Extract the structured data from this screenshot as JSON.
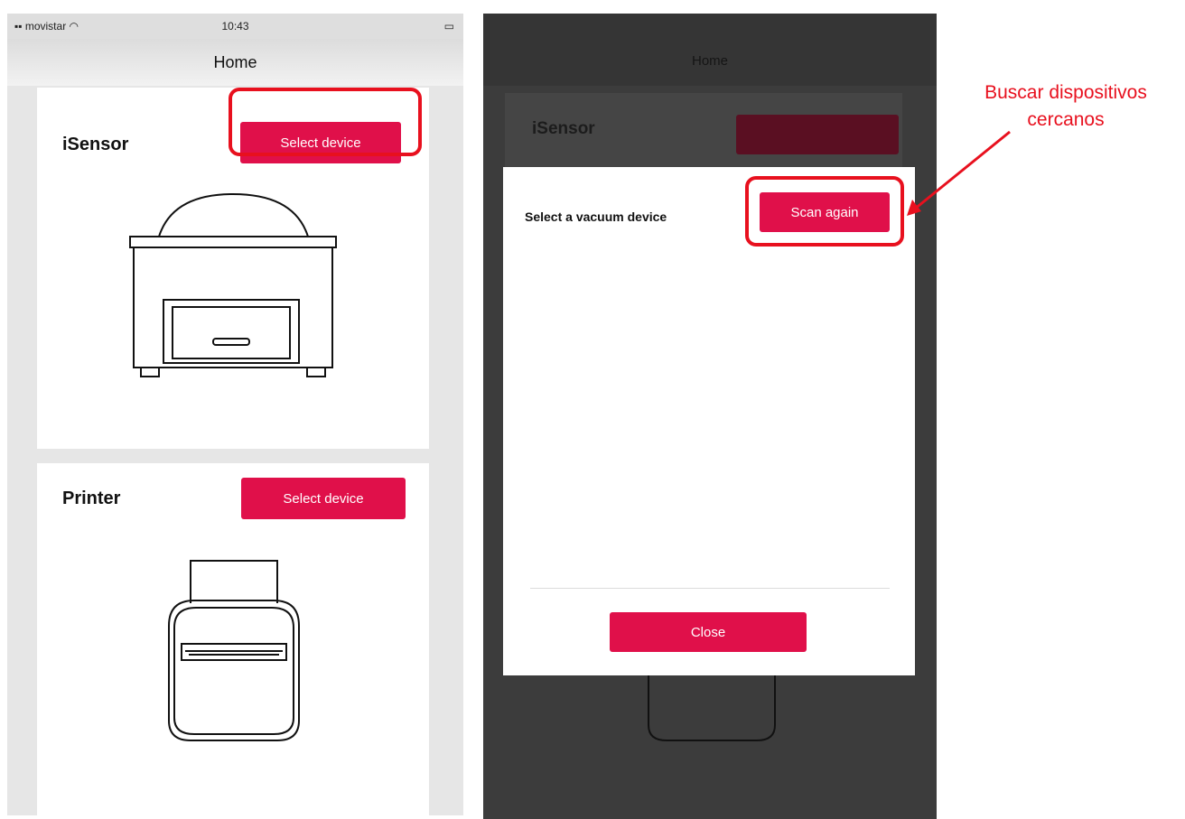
{
  "left_phone": {
    "status_bar": {
      "carrier": "movistar",
      "time": "10:43"
    },
    "nav_title": "Home",
    "cards": [
      {
        "title": "iSensor",
        "button": "Select device",
        "device": "vacuum-machine"
      },
      {
        "title": "Printer",
        "button": "Select device",
        "device": "label-printer"
      }
    ]
  },
  "right_phone": {
    "nav_title": "Home",
    "background_card_title": "iSensor",
    "modal": {
      "title": "Select a vacuum device",
      "scan_button": "Scan again",
      "close_button": "Close"
    }
  },
  "annotation": {
    "line1": "Buscar dispositivos",
    "line2": "cercanos",
    "color": "#e8101e"
  },
  "colors": {
    "accent": "#e0104a",
    "highlight": "#e8101e"
  }
}
